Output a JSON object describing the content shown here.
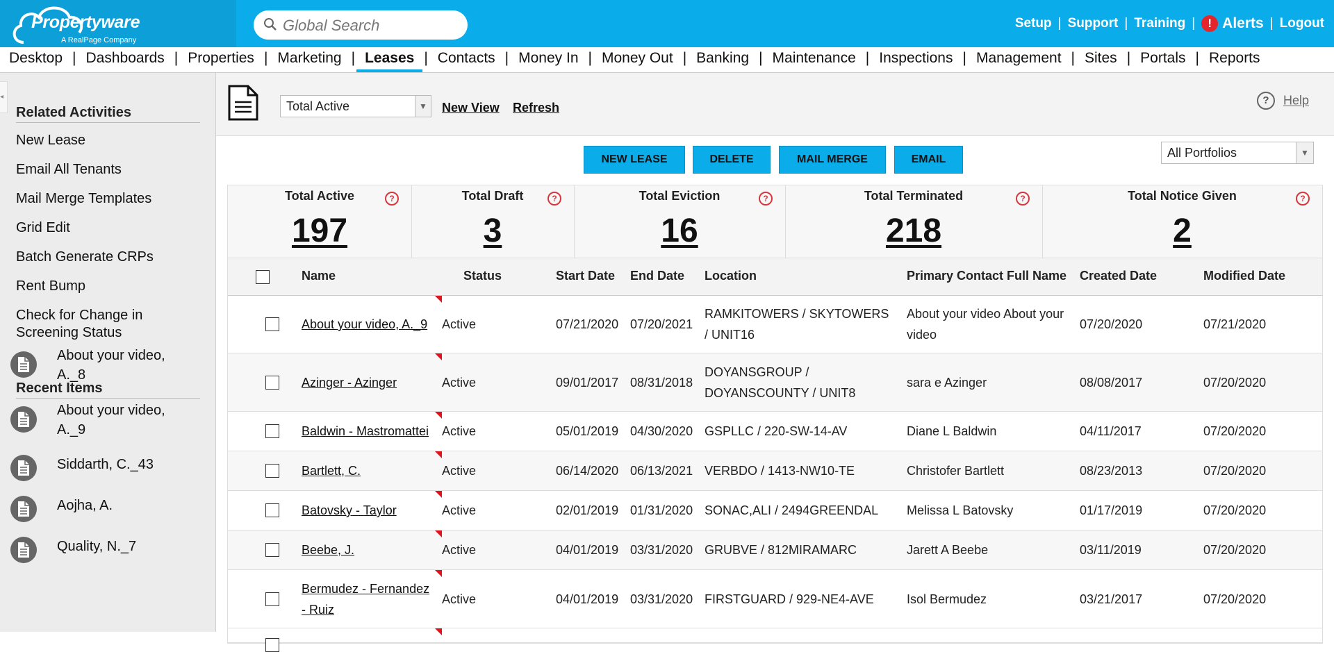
{
  "header": {
    "logo": "Propertyware",
    "logo_sub": "A RealPage Company",
    "search_placeholder": "Global Search",
    "links": [
      "Setup",
      "Support",
      "Training"
    ],
    "alerts_label": "Alerts",
    "alert_mark": "!",
    "logout_label": "Logout"
  },
  "nav": [
    "Desktop",
    "Dashboards",
    "Properties",
    "Marketing",
    "Leases",
    "Contacts",
    "Money In",
    "Money Out",
    "Banking",
    "Maintenance",
    "Inspections",
    "Management",
    "Sites",
    "Portals",
    "Reports"
  ],
  "nav_active": "Leases",
  "sidebar": {
    "related_title": "Related Activities",
    "related": [
      "New Lease",
      "Email All Tenants",
      "Mail Merge Templates",
      "Grid Edit",
      "Batch Generate CRPs",
      "Rent Bump",
      "Check for Change in Screening Status"
    ],
    "recent_title": "Recent Items",
    "recent": [
      "About your video, A._8",
      "About your video, A._9",
      "Siddarth, C._43",
      "Aojha, A.",
      "Quality, N._7"
    ]
  },
  "toolbar": {
    "view_value": "Total Active",
    "new_view": "New View",
    "refresh": "Refresh",
    "help": "Help"
  },
  "buttons": {
    "new_lease": "NEW LEASE",
    "delete": "DELETE",
    "mail_merge": "MAIL MERGE",
    "email": "EMAIL"
  },
  "portfolio_value": "All Portfolios",
  "stats": [
    {
      "label": "Total Active",
      "value": "197"
    },
    {
      "label": "Total Draft",
      "value": "3"
    },
    {
      "label": "Total Eviction",
      "value": "16"
    },
    {
      "label": "Total Terminated",
      "value": "218"
    },
    {
      "label": "Total Notice Given",
      "value": "2"
    }
  ],
  "table": {
    "columns": [
      "Name",
      "Status",
      "Start Date",
      "End Date",
      "Location",
      "Primary Contact Full Name",
      "Created Date",
      "Modified Date"
    ],
    "rows": [
      {
        "name": [
          "About your video, A._9"
        ],
        "status": "Active",
        "start": "07/21/2020",
        "end": "07/20/2021",
        "location": [
          "RAMKITOWERS / SKYTOWERS",
          "/ UNIT16"
        ],
        "contact": [
          "About your video About your",
          "video"
        ],
        "created": "07/20/2020",
        "modified": "07/21/2020"
      },
      {
        "name": [
          "Azinger - Azinger"
        ],
        "status": "Active",
        "start": "09/01/2017",
        "end": "08/31/2018",
        "location": [
          "DOYANSGROUP /",
          "DOYANSCOUNTY / UNIT8"
        ],
        "contact": [
          "sara e Azinger"
        ],
        "created": "08/08/2017",
        "modified": "07/20/2020"
      },
      {
        "name": [
          "Baldwin - Mastromattei"
        ],
        "status": "Active",
        "start": "05/01/2019",
        "end": "04/30/2020",
        "location": [
          "GSPLLC / 220-SW-14-AV"
        ],
        "contact": [
          "Diane L Baldwin"
        ],
        "created": "04/11/2017",
        "modified": "07/20/2020"
      },
      {
        "name": [
          "Bartlett, C."
        ],
        "status": "Active",
        "start": "06/14/2020",
        "end": "06/13/2021",
        "location": [
          "VERBDO / 1413-NW10-TE"
        ],
        "contact": [
          "Christofer Bartlett"
        ],
        "created": "08/23/2013",
        "modified": "07/20/2020"
      },
      {
        "name": [
          "Batovsky - Taylor"
        ],
        "status": "Active",
        "start": "02/01/2019",
        "end": "01/31/2020",
        "location": [
          "SONAC,ALI / 2494GREENDAL"
        ],
        "contact": [
          "Melissa L Batovsky"
        ],
        "created": "01/17/2019",
        "modified": "07/20/2020"
      },
      {
        "name": [
          "Beebe, J."
        ],
        "status": "Active",
        "start": "04/01/2019",
        "end": "03/31/2020",
        "location": [
          "GRUBVE / 812MIRAMARC"
        ],
        "contact": [
          "Jarett A Beebe"
        ],
        "created": "03/11/2019",
        "modified": "07/20/2020"
      },
      {
        "name": [
          "Bermudez - Fernandez",
          "- Ruiz"
        ],
        "status": "Active",
        "start": "04/01/2019",
        "end": "03/31/2020",
        "location": [
          "FIRSTGUARD / 929-NE4-AVE"
        ],
        "contact": [
          "Isol Bermudez"
        ],
        "created": "03/21/2017",
        "modified": "07/20/2020"
      }
    ]
  }
}
